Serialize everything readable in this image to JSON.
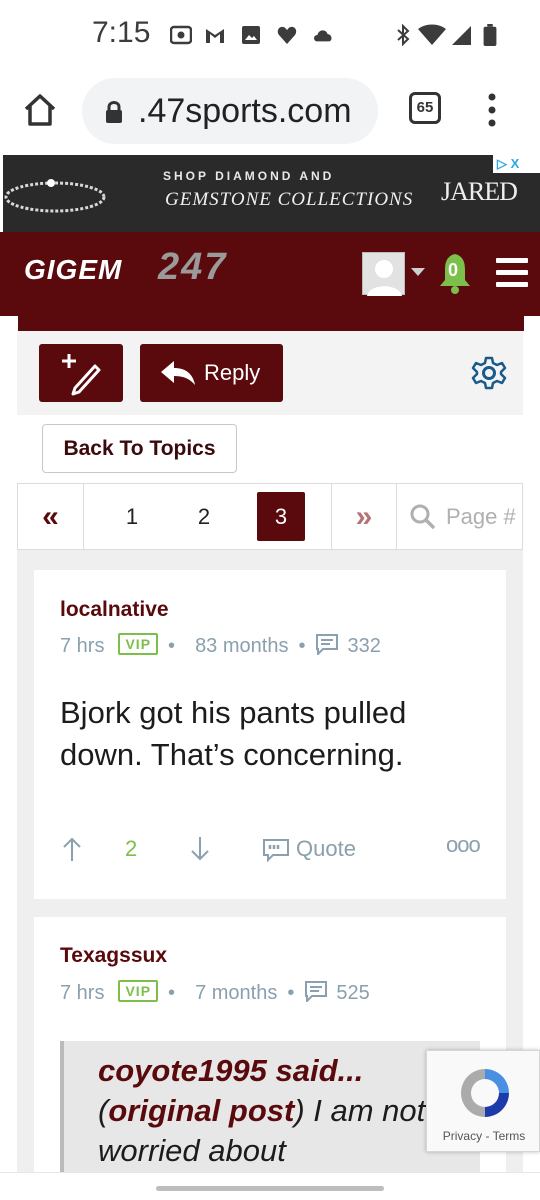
{
  "status_bar": {
    "time": "7:15",
    "icons": [
      "radio-icon",
      "gmail-icon",
      "image-icon",
      "heart-icon",
      "cloud-icon",
      "bluetooth-icon",
      "wifi-icon",
      "signal-icon",
      "battery-icon"
    ]
  },
  "browser": {
    "url": ".47sports.com",
    "tab_count": "65",
    "icons": [
      "home-icon",
      "lock-icon",
      "more-vert-icon"
    ]
  },
  "ad": {
    "line1": "SHOP DIAMOND AND",
    "line2": "GEMSTONE COLLECTIONS",
    "brand": "JARED",
    "choice": "▷ X"
  },
  "site": {
    "logo_part1": "GIGEM",
    "logo_part2": "247",
    "notification_count": "0",
    "colors": {
      "brand": "#5a0a0d",
      "vip": "#7cbf4a",
      "meta": "#8aa0ae"
    }
  },
  "toolbar": {
    "reply_label": "Reply"
  },
  "nav": {
    "back_label": "Back To Topics"
  },
  "pagination": {
    "first": "«",
    "pages": [
      "1",
      "2",
      "3"
    ],
    "current_page": "3",
    "last": "»",
    "search_placeholder": "Page #"
  },
  "posts": [
    {
      "author": "localnative",
      "time": "7 hrs",
      "badge": "VIP",
      "tenure": "83 months",
      "post_count": "332",
      "text": "Bjork got his pants pulled down. That’s concerning.",
      "votes": "2",
      "quote_label": "Quote",
      "more": "ooo"
    },
    {
      "author": "Texagssux",
      "time": "7 hrs",
      "badge": "VIP",
      "tenure": "7 months",
      "post_count": "525",
      "quote_author": "coyote1995 said...",
      "quote_link": "original post",
      "quote_text": "I am not worried about"
    }
  ],
  "recaptcha": {
    "privacy": "Privacy",
    "separator": " - ",
    "terms": "Terms"
  }
}
